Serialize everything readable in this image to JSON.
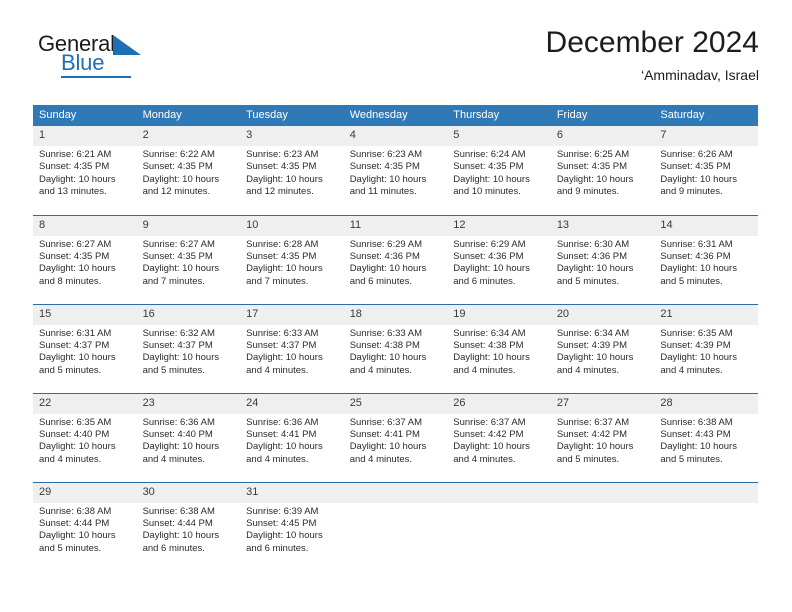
{
  "brand": {
    "name_top": "General",
    "name_bottom": "Blue",
    "logo_icon": "blue-triangle-icon",
    "accent_color": "#1f6fb5"
  },
  "header": {
    "title": "December 2024",
    "subtitle": "‘Amminadav, Israel"
  },
  "colors": {
    "header_row": "#3079b7",
    "daynum_band": "#efefef",
    "row_divider": "#2a6da8",
    "text": "#2b2b2b"
  },
  "calendar": {
    "weekday_headers": [
      "Sunday",
      "Monday",
      "Tuesday",
      "Wednesday",
      "Thursday",
      "Friday",
      "Saturday"
    ],
    "weeks": [
      [
        {
          "day": "1",
          "sunrise": "Sunrise: 6:21 AM",
          "sunset": "Sunset: 4:35 PM",
          "daylight": "Daylight: 10 hours and 13 minutes."
        },
        {
          "day": "2",
          "sunrise": "Sunrise: 6:22 AM",
          "sunset": "Sunset: 4:35 PM",
          "daylight": "Daylight: 10 hours and 12 minutes."
        },
        {
          "day": "3",
          "sunrise": "Sunrise: 6:23 AM",
          "sunset": "Sunset: 4:35 PM",
          "daylight": "Daylight: 10 hours and 12 minutes."
        },
        {
          "day": "4",
          "sunrise": "Sunrise: 6:23 AM",
          "sunset": "Sunset: 4:35 PM",
          "daylight": "Daylight: 10 hours and 11 minutes."
        },
        {
          "day": "5",
          "sunrise": "Sunrise: 6:24 AM",
          "sunset": "Sunset: 4:35 PM",
          "daylight": "Daylight: 10 hours and 10 minutes."
        },
        {
          "day": "6",
          "sunrise": "Sunrise: 6:25 AM",
          "sunset": "Sunset: 4:35 PM",
          "daylight": "Daylight: 10 hours and 9 minutes."
        },
        {
          "day": "7",
          "sunrise": "Sunrise: 6:26 AM",
          "sunset": "Sunset: 4:35 PM",
          "daylight": "Daylight: 10 hours and 9 minutes."
        }
      ],
      [
        {
          "day": "8",
          "sunrise": "Sunrise: 6:27 AM",
          "sunset": "Sunset: 4:35 PM",
          "daylight": "Daylight: 10 hours and 8 minutes."
        },
        {
          "day": "9",
          "sunrise": "Sunrise: 6:27 AM",
          "sunset": "Sunset: 4:35 PM",
          "daylight": "Daylight: 10 hours and 7 minutes."
        },
        {
          "day": "10",
          "sunrise": "Sunrise: 6:28 AM",
          "sunset": "Sunset: 4:35 PM",
          "daylight": "Daylight: 10 hours and 7 minutes."
        },
        {
          "day": "11",
          "sunrise": "Sunrise: 6:29 AM",
          "sunset": "Sunset: 4:36 PM",
          "daylight": "Daylight: 10 hours and 6 minutes."
        },
        {
          "day": "12",
          "sunrise": "Sunrise: 6:29 AM",
          "sunset": "Sunset: 4:36 PM",
          "daylight": "Daylight: 10 hours and 6 minutes."
        },
        {
          "day": "13",
          "sunrise": "Sunrise: 6:30 AM",
          "sunset": "Sunset: 4:36 PM",
          "daylight": "Daylight: 10 hours and 5 minutes."
        },
        {
          "day": "14",
          "sunrise": "Sunrise: 6:31 AM",
          "sunset": "Sunset: 4:36 PM",
          "daylight": "Daylight: 10 hours and 5 minutes."
        }
      ],
      [
        {
          "day": "15",
          "sunrise": "Sunrise: 6:31 AM",
          "sunset": "Sunset: 4:37 PM",
          "daylight": "Daylight: 10 hours and 5 minutes."
        },
        {
          "day": "16",
          "sunrise": "Sunrise: 6:32 AM",
          "sunset": "Sunset: 4:37 PM",
          "daylight": "Daylight: 10 hours and 5 minutes."
        },
        {
          "day": "17",
          "sunrise": "Sunrise: 6:33 AM",
          "sunset": "Sunset: 4:37 PM",
          "daylight": "Daylight: 10 hours and 4 minutes."
        },
        {
          "day": "18",
          "sunrise": "Sunrise: 6:33 AM",
          "sunset": "Sunset: 4:38 PM",
          "daylight": "Daylight: 10 hours and 4 minutes."
        },
        {
          "day": "19",
          "sunrise": "Sunrise: 6:34 AM",
          "sunset": "Sunset: 4:38 PM",
          "daylight": "Daylight: 10 hours and 4 minutes."
        },
        {
          "day": "20",
          "sunrise": "Sunrise: 6:34 AM",
          "sunset": "Sunset: 4:39 PM",
          "daylight": "Daylight: 10 hours and 4 minutes."
        },
        {
          "day": "21",
          "sunrise": "Sunrise: 6:35 AM",
          "sunset": "Sunset: 4:39 PM",
          "daylight": "Daylight: 10 hours and 4 minutes."
        }
      ],
      [
        {
          "day": "22",
          "sunrise": "Sunrise: 6:35 AM",
          "sunset": "Sunset: 4:40 PM",
          "daylight": "Daylight: 10 hours and 4 minutes."
        },
        {
          "day": "23",
          "sunrise": "Sunrise: 6:36 AM",
          "sunset": "Sunset: 4:40 PM",
          "daylight": "Daylight: 10 hours and 4 minutes."
        },
        {
          "day": "24",
          "sunrise": "Sunrise: 6:36 AM",
          "sunset": "Sunset: 4:41 PM",
          "daylight": "Daylight: 10 hours and 4 minutes."
        },
        {
          "day": "25",
          "sunrise": "Sunrise: 6:37 AM",
          "sunset": "Sunset: 4:41 PM",
          "daylight": "Daylight: 10 hours and 4 minutes."
        },
        {
          "day": "26",
          "sunrise": "Sunrise: 6:37 AM",
          "sunset": "Sunset: 4:42 PM",
          "daylight": "Daylight: 10 hours and 4 minutes."
        },
        {
          "day": "27",
          "sunrise": "Sunrise: 6:37 AM",
          "sunset": "Sunset: 4:42 PM",
          "daylight": "Daylight: 10 hours and 5 minutes."
        },
        {
          "day": "28",
          "sunrise": "Sunrise: 6:38 AM",
          "sunset": "Sunset: 4:43 PM",
          "daylight": "Daylight: 10 hours and 5 minutes."
        }
      ],
      [
        {
          "day": "29",
          "sunrise": "Sunrise: 6:38 AM",
          "sunset": "Sunset: 4:44 PM",
          "daylight": "Daylight: 10 hours and 5 minutes."
        },
        {
          "day": "30",
          "sunrise": "Sunrise: 6:38 AM",
          "sunset": "Sunset: 4:44 PM",
          "daylight": "Daylight: 10 hours and 6 minutes."
        },
        {
          "day": "31",
          "sunrise": "Sunrise: 6:39 AM",
          "sunset": "Sunset: 4:45 PM",
          "daylight": "Daylight: 10 hours and 6 minutes."
        },
        {
          "day": "",
          "sunrise": "",
          "sunset": "",
          "daylight": ""
        },
        {
          "day": "",
          "sunrise": "",
          "sunset": "",
          "daylight": ""
        },
        {
          "day": "",
          "sunrise": "",
          "sunset": "",
          "daylight": ""
        },
        {
          "day": "",
          "sunrise": "",
          "sunset": "",
          "daylight": ""
        }
      ]
    ]
  }
}
